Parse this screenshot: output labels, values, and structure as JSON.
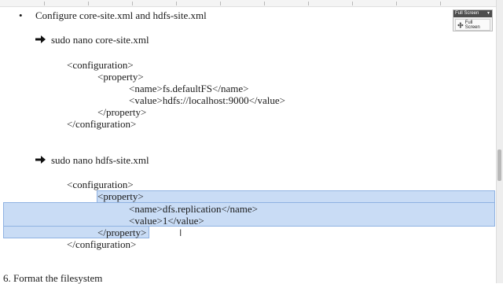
{
  "document": {
    "bullet_char": "•",
    "bullet_text": "Configure core-site.xml and hdfs-site.xml",
    "step1_cmd": "sudo nano core-site.xml",
    "core": {
      "open_config": "<configuration>",
      "open_property": "<property>",
      "name": "<name>fs.defaultFS</name>",
      "value": "<value>hdfs://localhost:9000</value>",
      "close_property": "</property>",
      "close_config": "</configuration>"
    },
    "step2_cmd": "sudo nano hdfs-site.xml",
    "hdfs": {
      "open_config": "<configuration>",
      "open_property": "<property>",
      "name": "<name>dfs.replication</name>",
      "value": "<value>1</value>",
      "close_property": "</property>",
      "close_config": "</configuration>"
    },
    "section_heading": "6. Format the filesystem"
  },
  "full_screen_toolbar": {
    "title": "Full Screen",
    "button_label": "Full Screen"
  },
  "selection_color": "#c9dcf5"
}
